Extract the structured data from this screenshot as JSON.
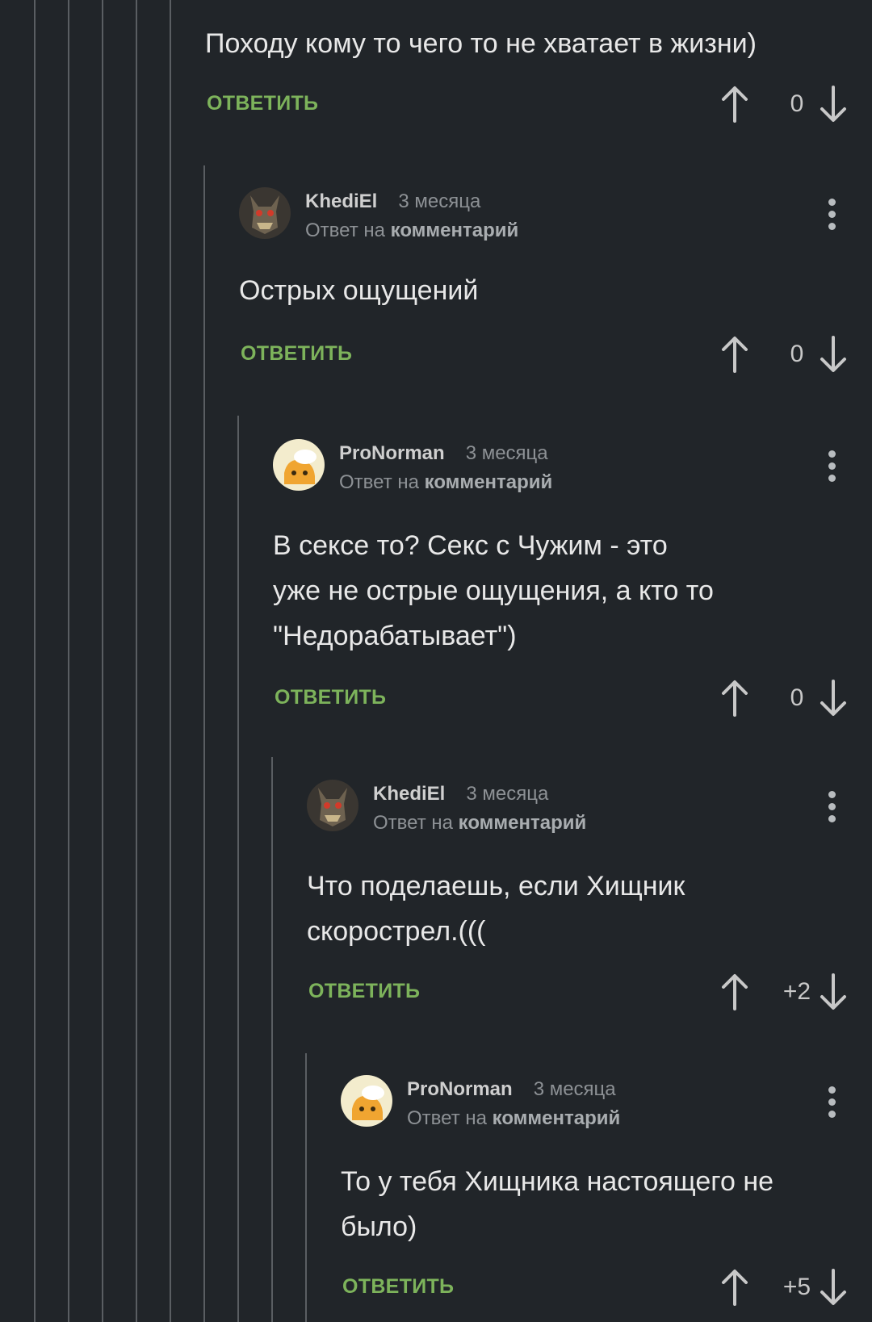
{
  "labels": {
    "reply": "ОТВЕТИТЬ",
    "reply_to": "Ответ на ",
    "reply_to_link": "комментарий"
  },
  "colors": {
    "background": "#212529",
    "reply_green": "#7db35b",
    "thread_line": "#5a5e62"
  },
  "comments": [
    {
      "text": "Походу кому то чего то не хватает в жизни)",
      "score": "0"
    },
    {
      "author": "KhediEl",
      "time": "3 месяца",
      "avatar_icon": "creature-avatar-icon",
      "text": "Острых ощущений",
      "score": "0"
    },
    {
      "author": "ProNorman",
      "time": "3 месяца",
      "avatar_icon": "cartoon-avatar-icon",
      "text_lines": [
        "В сексе то? Секс с Чужим - это",
        "уже не острые ощущения, а кто то",
        "\"Недорабатывает\")"
      ],
      "score": "0"
    },
    {
      "author": "KhediEl",
      "time": "3 месяца",
      "avatar_icon": "creature-avatar-icon",
      "text_lines": [
        "Что поделаешь, если Хищник",
        "скорострел.((("
      ],
      "score": "+2"
    },
    {
      "author": "ProNorman",
      "time": "3 месяца",
      "avatar_icon": "cartoon-avatar-icon",
      "text_lines": [
        "То у тебя Хищника настоящего не",
        "было)"
      ],
      "score": "+5"
    }
  ]
}
